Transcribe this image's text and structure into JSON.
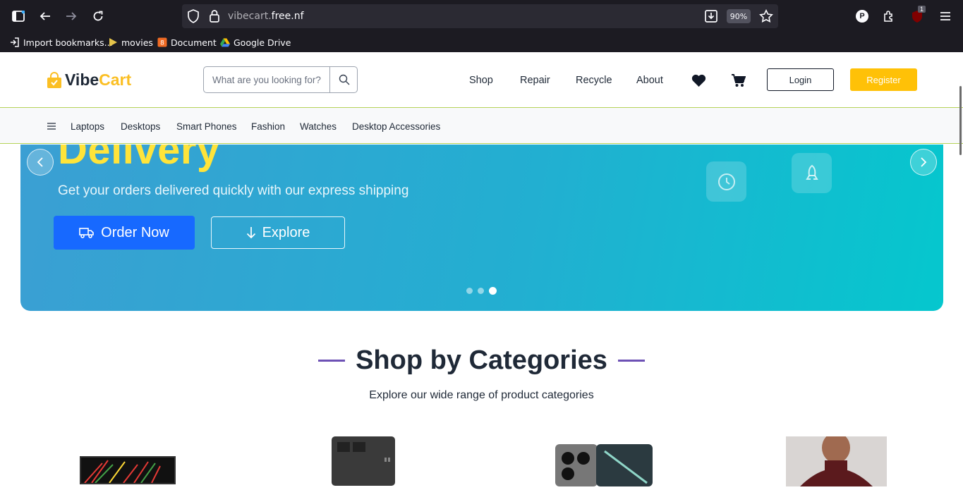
{
  "browser": {
    "url_prefix": "vibecart.",
    "url_domain": "free.nf",
    "zoom": "90%",
    "bookmarks": [
      {
        "label": "Import bookmarks..."
      },
      {
        "label": "movies"
      },
      {
        "label": "Document"
      },
      {
        "label": "Google Drive"
      }
    ],
    "profile_initial": "P",
    "ublock_badge": "1"
  },
  "header": {
    "logo_vibe": "Vibe",
    "logo_cart": "Cart",
    "search_placeholder": "What are you looking for?",
    "nav": [
      "Shop",
      "Repair",
      "Recycle",
      "About"
    ],
    "login_label": "Login",
    "register_label": "Register"
  },
  "categories_nav": [
    "Laptops",
    "Desktops",
    "Smart Phones",
    "Fashion",
    "Watches",
    "Desktop Accessories"
  ],
  "hero": {
    "title": "Delivery",
    "subtitle": "Get your orders delivered quickly with our express shipping",
    "order_label": "Order Now",
    "explore_label": "Explore",
    "slide_count": 3,
    "active_slide": 3
  },
  "section": {
    "title": "Shop by Categories",
    "subtitle": "Explore our wide range of product categories"
  },
  "colors": {
    "brand_yellow": "#fbbf24",
    "register_yellow": "#ffc107",
    "order_blue": "#1769ff",
    "title_line": "#6d52b5"
  }
}
